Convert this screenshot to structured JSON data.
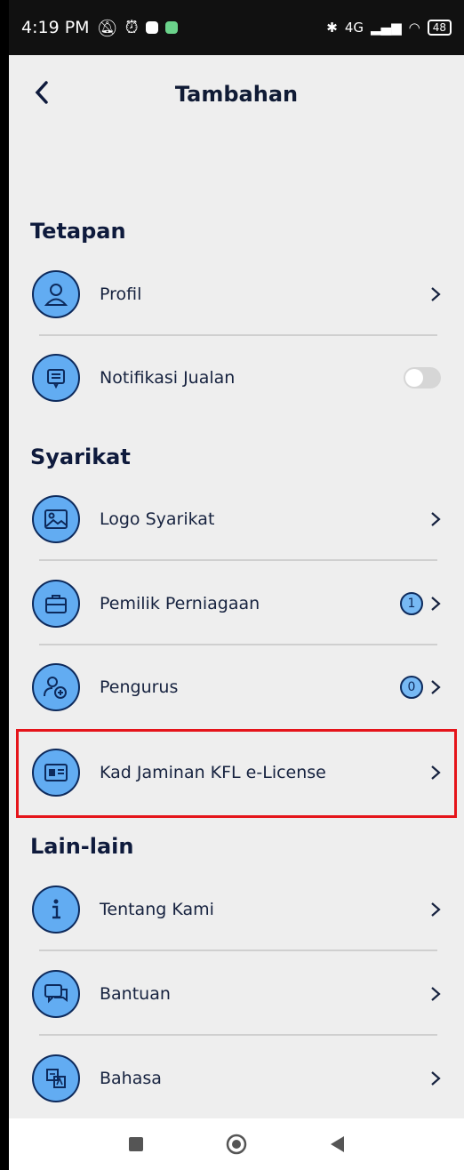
{
  "status": {
    "time": "4:19 PM",
    "battery": "48",
    "net": "4G"
  },
  "header": {
    "title": "Tambahan"
  },
  "sections": {
    "tetapan": "Tetapan",
    "syarikat": "Syarikat",
    "lain": "Lain-lain"
  },
  "items": {
    "profil": "Profil",
    "notifikasi": "Notifikasi Jualan",
    "logo": "Logo Syarikat",
    "pemilik": "Pemilik Perniagaan",
    "pemilik_count": "1",
    "pengurus": "Pengurus",
    "pengurus_count": "0",
    "kad": "Kad Jaminan KFL e-License",
    "tentang": "Tentang Kami",
    "bantuan": "Bantuan",
    "bahasa": "Bahasa"
  },
  "colors": {
    "icon_fill": "#62acf2",
    "icon_stroke": "#0d2a5c",
    "highlight": "#e5141a"
  }
}
